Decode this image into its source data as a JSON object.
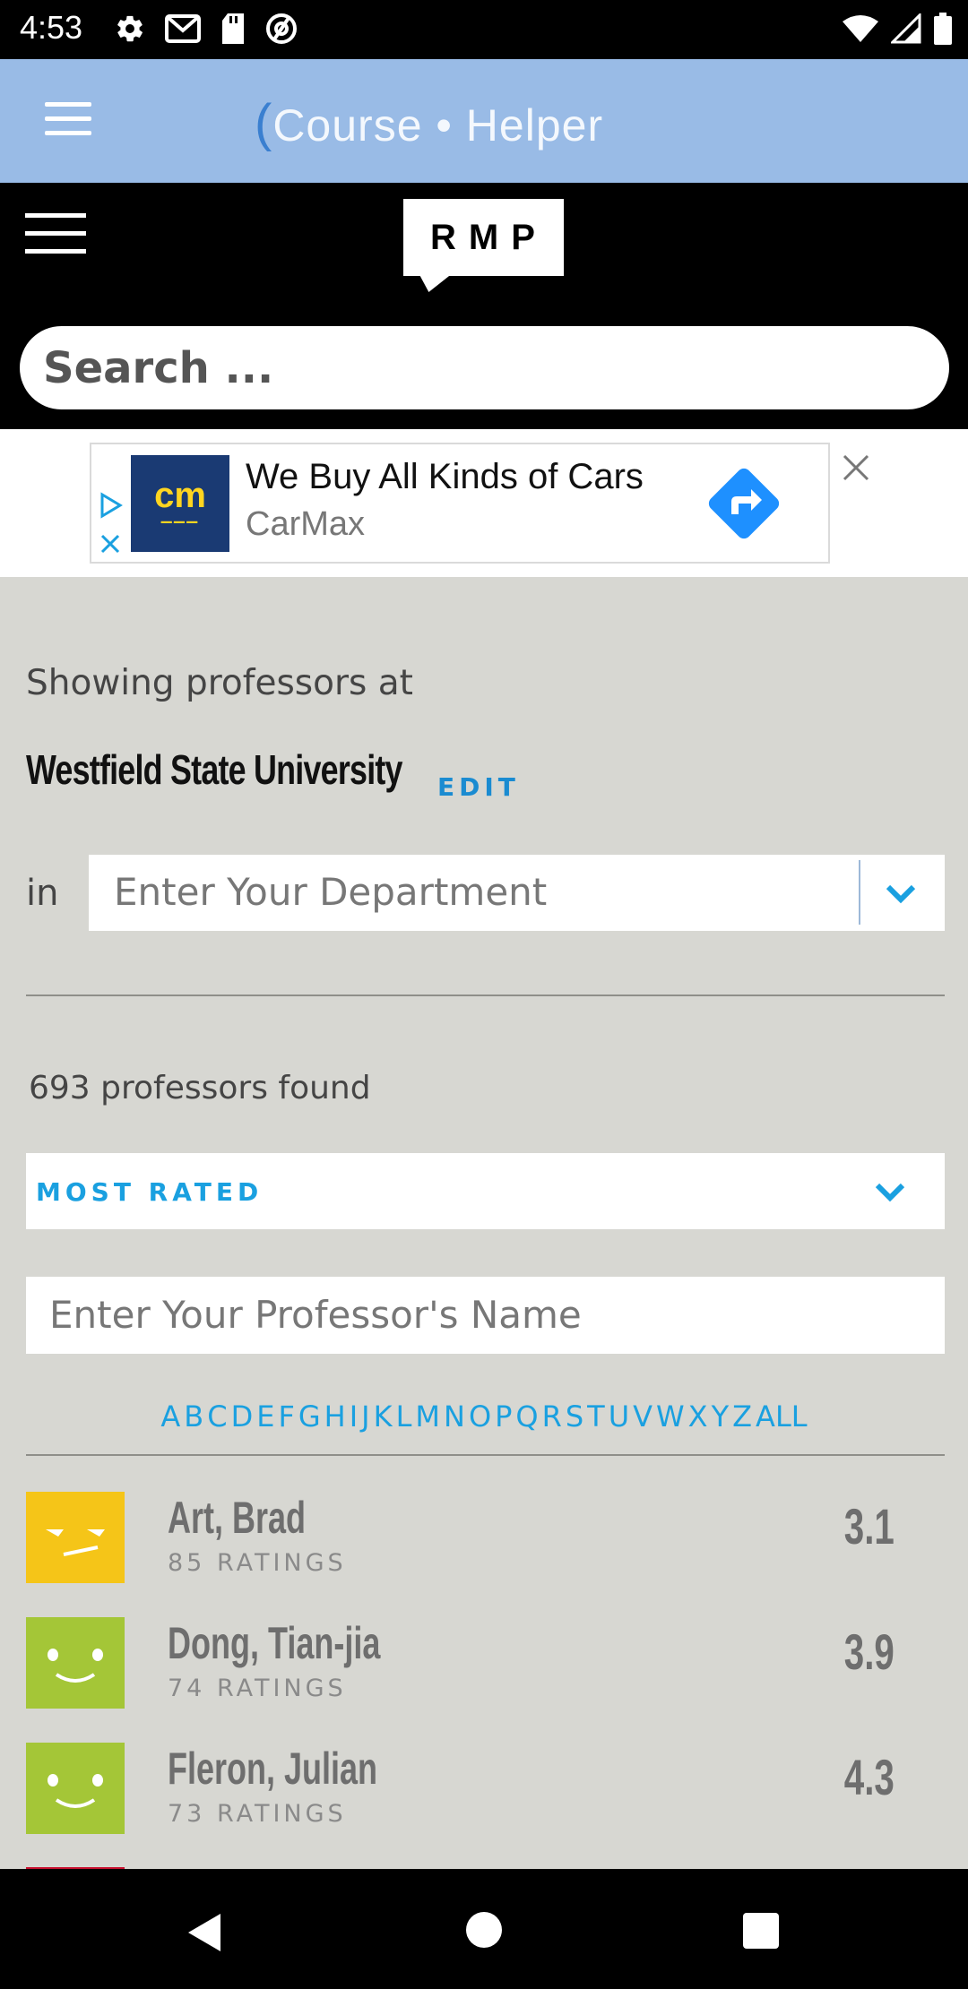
{
  "status_bar": {
    "time": "4:53",
    "left_icons": [
      "gear-icon",
      "gmail-icon",
      "sd-card-icon",
      "at-sign-icon"
    ],
    "right_icons": [
      "wifi-icon",
      "signal-icon",
      "battery-icon"
    ]
  },
  "course_helper": {
    "logo_text": "Course • Helper"
  },
  "rmp": {
    "logo": "RMP",
    "search_placeholder": "Search ..."
  },
  "ad": {
    "brand_logo": "cm",
    "title": "We Buy All Kinds of Cars",
    "advertiser": "CarMax",
    "colors": {
      "logo_bg": "#1a3a73",
      "logo_text": "#ffd520",
      "cta": "#1e90ff"
    }
  },
  "main": {
    "showing_text": "Showing professors at",
    "school": "Westfield State University",
    "edit_label": "EDIT",
    "in_label": "in",
    "department_placeholder": "Enter Your Department",
    "found_text": "693 professors found",
    "sort_label": "MOST RATED",
    "professor_placeholder": "Enter Your Professor's Name",
    "alphabet": [
      "A",
      "B",
      "C",
      "D",
      "E",
      "F",
      "G",
      "H",
      "I",
      "J",
      "K",
      "L",
      "M",
      "N",
      "O",
      "P",
      "Q",
      "R",
      "S",
      "T",
      "U",
      "V",
      "W",
      "X",
      "Y",
      "Z",
      "ALL"
    ],
    "professors": [
      {
        "name": "Art, Brad",
        "ratings": "85 RATINGS",
        "score": "3.1",
        "face": "meh",
        "color": "#f5c518"
      },
      {
        "name": "Dong, Tian-jia",
        "ratings": "74 RATINGS",
        "score": "3.9",
        "face": "happy",
        "color": "#a4c637"
      },
      {
        "name": "Fleron, Julian",
        "ratings": "73 RATINGS",
        "score": "4.3",
        "face": "happy",
        "color": "#a4c637"
      }
    ],
    "colors": {
      "accent": "#1aa0e0",
      "background": "#d7d7d2"
    }
  },
  "nav": {
    "icons": [
      "back-icon",
      "home-icon",
      "recents-icon"
    ]
  }
}
